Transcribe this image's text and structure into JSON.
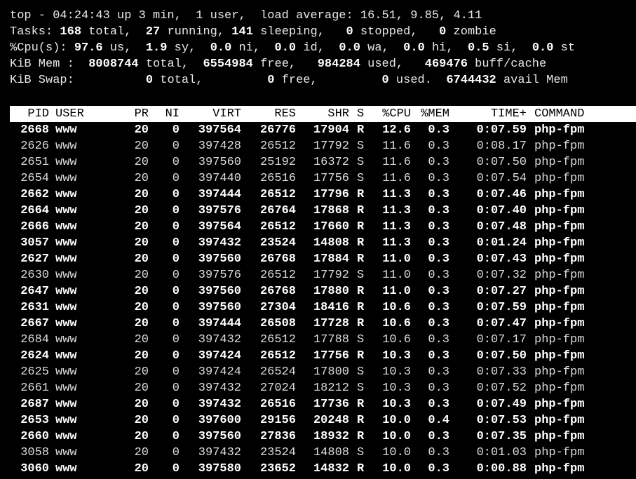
{
  "summary": {
    "line1": "top - 04:24:43 up 3 min,  1 user,  load average: 16.51, 9.85, 4.11",
    "tasks": {
      "label": "Tasks:",
      "total": "168",
      "total_lbl": " total,  ",
      "running": "27",
      "running_lbl": " running, ",
      "sleeping": "141",
      "sleeping_lbl": " sleeping,   ",
      "stopped": "0",
      "stopped_lbl": " stopped,   ",
      "zombie": "0",
      "zombie_lbl": " zombie"
    },
    "cpu": {
      "label": "%Cpu(s): ",
      "us": "97.6",
      "us_lbl": " us,  ",
      "sy": "1.9",
      "sy_lbl": " sy,  ",
      "ni": "0.0",
      "ni_lbl": " ni,  ",
      "id": "0.0",
      "id_lbl": " id,  ",
      "wa": "0.0",
      "wa_lbl": " wa,  ",
      "hi": "0.0",
      "hi_lbl": " hi,  ",
      "si": "0.5",
      "si_lbl": " si,  ",
      "st": "0.0",
      "st_lbl": " st"
    },
    "mem": {
      "label": "KiB Mem :  ",
      "total": "8008744",
      "total_lbl": " total,  ",
      "free": "6554984",
      "free_lbl": " free,   ",
      "used": "984284",
      "used_lbl": " used,   ",
      "cache": "469476",
      "cache_lbl": " buff/cache"
    },
    "swap": {
      "label": "KiB Swap:          ",
      "total": "0",
      "total_lbl": " total,         ",
      "free": "0",
      "free_lbl": " free,         ",
      "used": "0",
      "used_lbl": " used.  ",
      "avail": "6744432",
      "avail_lbl": " avail Mem"
    }
  },
  "columns": [
    "PID",
    "USER",
    "PR",
    "NI",
    "VIRT",
    "RES",
    "SHR",
    "S",
    "%CPU",
    "%MEM",
    "TIME+",
    "COMMAND"
  ],
  "processes": [
    [
      "2668",
      "www",
      "20",
      "0",
      "397564",
      "26776",
      "17904",
      "R",
      "12.6",
      "0.3",
      "0:07.59",
      "php-fpm"
    ],
    [
      "2626",
      "www",
      "20",
      "0",
      "397428",
      "26512",
      "17792",
      "S",
      "11.6",
      "0.3",
      "0:08.17",
      "php-fpm"
    ],
    [
      "2651",
      "www",
      "20",
      "0",
      "397560",
      "25192",
      "16372",
      "S",
      "11.6",
      "0.3",
      "0:07.50",
      "php-fpm"
    ],
    [
      "2654",
      "www",
      "20",
      "0",
      "397440",
      "26516",
      "17756",
      "S",
      "11.6",
      "0.3",
      "0:07.54",
      "php-fpm"
    ],
    [
      "2662",
      "www",
      "20",
      "0",
      "397444",
      "26512",
      "17796",
      "R",
      "11.3",
      "0.3",
      "0:07.46",
      "php-fpm"
    ],
    [
      "2664",
      "www",
      "20",
      "0",
      "397576",
      "26764",
      "17868",
      "R",
      "11.3",
      "0.3",
      "0:07.40",
      "php-fpm"
    ],
    [
      "2666",
      "www",
      "20",
      "0",
      "397564",
      "26512",
      "17660",
      "R",
      "11.3",
      "0.3",
      "0:07.48",
      "php-fpm"
    ],
    [
      "3057",
      "www",
      "20",
      "0",
      "397432",
      "23524",
      "14808",
      "R",
      "11.3",
      "0.3",
      "0:01.24",
      "php-fpm"
    ],
    [
      "2627",
      "www",
      "20",
      "0",
      "397560",
      "26768",
      "17884",
      "R",
      "11.0",
      "0.3",
      "0:07.43",
      "php-fpm"
    ],
    [
      "2630",
      "www",
      "20",
      "0",
      "397576",
      "26512",
      "17792",
      "S",
      "11.0",
      "0.3",
      "0:07.32",
      "php-fpm"
    ],
    [
      "2647",
      "www",
      "20",
      "0",
      "397560",
      "26768",
      "17880",
      "R",
      "11.0",
      "0.3",
      "0:07.27",
      "php-fpm"
    ],
    [
      "2631",
      "www",
      "20",
      "0",
      "397560",
      "27304",
      "18416",
      "R",
      "10.6",
      "0.3",
      "0:07.59",
      "php-fpm"
    ],
    [
      "2667",
      "www",
      "20",
      "0",
      "397444",
      "26508",
      "17728",
      "R",
      "10.6",
      "0.3",
      "0:07.47",
      "php-fpm"
    ],
    [
      "2684",
      "www",
      "20",
      "0",
      "397432",
      "26512",
      "17788",
      "S",
      "10.6",
      "0.3",
      "0:07.17",
      "php-fpm"
    ],
    [
      "2624",
      "www",
      "20",
      "0",
      "397424",
      "26512",
      "17756",
      "R",
      "10.3",
      "0.3",
      "0:07.50",
      "php-fpm"
    ],
    [
      "2625",
      "www",
      "20",
      "0",
      "397424",
      "26524",
      "17800",
      "S",
      "10.3",
      "0.3",
      "0:07.33",
      "php-fpm"
    ],
    [
      "2661",
      "www",
      "20",
      "0",
      "397432",
      "27024",
      "18212",
      "S",
      "10.3",
      "0.3",
      "0:07.52",
      "php-fpm"
    ],
    [
      "2687",
      "www",
      "20",
      "0",
      "397432",
      "26516",
      "17736",
      "R",
      "10.3",
      "0.3",
      "0:07.49",
      "php-fpm"
    ],
    [
      "2653",
      "www",
      "20",
      "0",
      "397600",
      "29156",
      "20248",
      "R",
      "10.0",
      "0.4",
      "0:07.53",
      "php-fpm"
    ],
    [
      "2660",
      "www",
      "20",
      "0",
      "397560",
      "27836",
      "18932",
      "R",
      "10.0",
      "0.3",
      "0:07.35",
      "php-fpm"
    ],
    [
      "3058",
      "www",
      "20",
      "0",
      "397432",
      "23524",
      "14808",
      "S",
      "10.0",
      "0.3",
      "0:01.03",
      "php-fpm"
    ],
    [
      "3060",
      "www",
      "20",
      "0",
      "397580",
      "23652",
      "14832",
      "R",
      "10.0",
      "0.3",
      "0:00.88",
      "php-fpm"
    ]
  ]
}
